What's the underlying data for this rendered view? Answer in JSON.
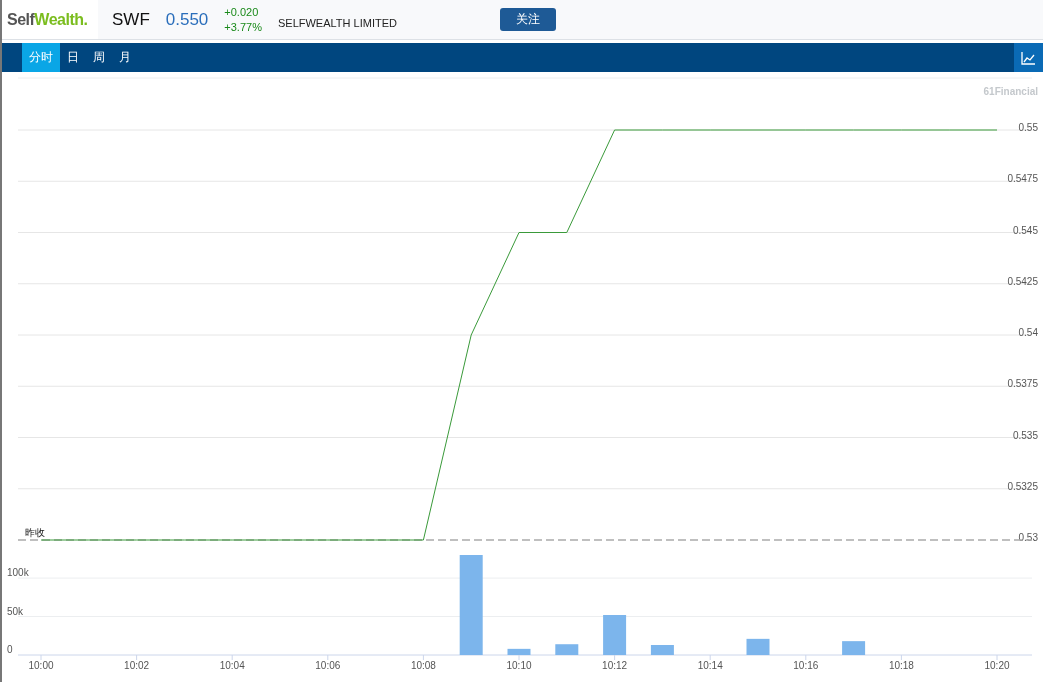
{
  "header": {
    "logo": [
      "Self",
      "Wealth."
    ],
    "symbol": "SWF",
    "price": "0.550",
    "change": "+0.020",
    "change_percent": "+3.77%",
    "company": "SELFWEALTH LIMITED",
    "follow_button": "关注"
  },
  "tabs": [
    {
      "label": "分时",
      "selected": true
    },
    {
      "label": "日",
      "selected": false
    },
    {
      "label": "周",
      "selected": false
    },
    {
      "label": "月",
      "selected": false
    }
  ],
  "credit": "61Financial",
  "price_chart": {
    "reference_label": "昨收",
    "chart_data": {
      "type": "line",
      "grid": true,
      "series": [
        {
          "color": "#3a9a3a",
          "values": [
            0.53,
            0.53,
            0.53,
            0.53,
            0.53,
            0.53,
            0.53,
            0.53,
            0.53,
            0.54,
            0.545,
            0.545,
            0.55,
            0.55,
            0.55,
            0.55,
            0.55,
            0.55,
            0.55,
            0.55,
            0.55
          ]
        }
      ],
      "ylim": [
        0.53,
        0.55
      ],
      "yticks": [
        {
          "value": 0.55,
          "label": "0.55"
        },
        {
          "value": 0.5475,
          "label": "0.5475"
        },
        {
          "value": 0.545,
          "label": "0.545"
        },
        {
          "value": 0.5425,
          "label": "0.5425"
        },
        {
          "value": 0.54,
          "label": "0.54"
        },
        {
          "value": 0.5375,
          "label": "0.5375"
        },
        {
          "value": 0.535,
          "label": "0.535"
        },
        {
          "value": 0.5325,
          "label": "0.5325"
        },
        {
          "value": 0.53,
          "label": "0.53"
        }
      ]
    }
  },
  "volume_chart": {
    "chart_data": {
      "type": "bar",
      "grid": true,
      "categories": [
        "10:00",
        null,
        "10:02",
        null,
        "10:04",
        null,
        "10:06",
        null,
        "10:08",
        null,
        "10:10",
        null,
        "10:12",
        null,
        "10:14",
        null,
        "10:16",
        null,
        "10:18",
        null,
        "10:20"
      ],
      "series": [
        {
          "color": "#7cb5ec",
          "values": [
            0,
            0,
            0,
            0,
            0,
            0,
            0,
            0,
            0,
            130000,
            8000,
            14000,
            52000,
            13000,
            0,
            21000,
            0,
            18000,
            0,
            0,
            0
          ]
        }
      ],
      "ylim": [
        0,
        130000
      ],
      "yticks": [
        {
          "value": 0,
          "label": "0"
        },
        {
          "value": 50000,
          "label": "50k"
        },
        {
          "value": 100000,
          "label": "100k"
        }
      ]
    }
  }
}
